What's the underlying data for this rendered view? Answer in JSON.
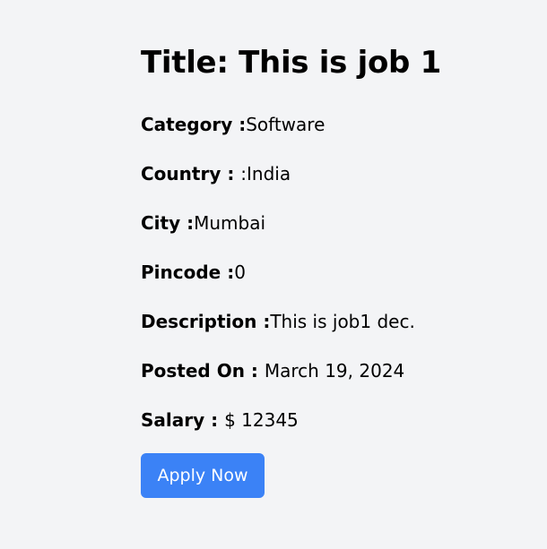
{
  "job": {
    "title": "Title: This is job 1",
    "fields": [
      {
        "label": "Category :",
        "value": "Software"
      },
      {
        "label": "Country : ",
        "value": ":India"
      },
      {
        "label": "City :",
        "value": "Mumbai"
      },
      {
        "label": "Pincode :",
        "value": "0"
      },
      {
        "label": "Description :",
        "value": "This is job1 dec."
      },
      {
        "label": "Posted On : ",
        "value": "March 19, 2024"
      },
      {
        "label": "Salary : ",
        "value": "$ 12345"
      }
    ],
    "apply_label": "Apply Now"
  },
  "colors": {
    "background": "#f3f4f6",
    "button": "#3b82f6",
    "button_text": "#ffffff"
  }
}
